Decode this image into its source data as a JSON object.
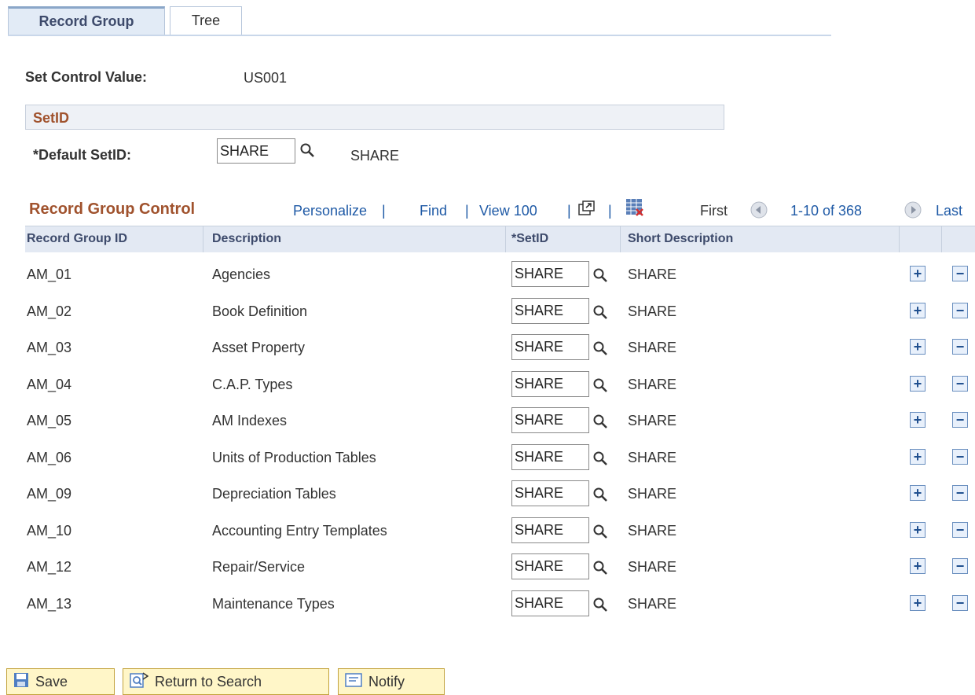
{
  "tabs": [
    {
      "label": "Record Group",
      "active": true
    },
    {
      "label": "Tree",
      "active": false
    }
  ],
  "set_control": {
    "label": "Set Control Value:",
    "value": "US001"
  },
  "setid_section": {
    "title": "SetID",
    "default_label": "*Default SetID:",
    "default_value": "SHARE",
    "default_description": "SHARE"
  },
  "grid": {
    "title": "Record Group Control",
    "personalize": "Personalize",
    "find": "Find",
    "view_all": "View 100",
    "sep": "|",
    "first": "First",
    "range": "1-10 of 368",
    "last": "Last",
    "columns": {
      "record_group_id": "Record Group ID",
      "description": "Description",
      "setid": "*SetID",
      "short_description": "Short Description"
    },
    "rows": [
      {
        "id": "AM_01",
        "description": "Agencies",
        "setid": "SHARE",
        "short": "SHARE"
      },
      {
        "id": "AM_02",
        "description": "Book Definition",
        "setid": "SHARE",
        "short": "SHARE"
      },
      {
        "id": "AM_03",
        "description": "Asset Property",
        "setid": "SHARE",
        "short": "SHARE"
      },
      {
        "id": "AM_04",
        "description": "C.A.P. Types",
        "setid": "SHARE",
        "short": "SHARE"
      },
      {
        "id": "AM_05",
        "description": "AM Indexes",
        "setid": "SHARE",
        "short": "SHARE"
      },
      {
        "id": "AM_06",
        "description": "Units of Production Tables",
        "setid": "SHARE",
        "short": "SHARE"
      },
      {
        "id": "AM_09",
        "description": "Depreciation Tables",
        "setid": "SHARE",
        "short": "SHARE"
      },
      {
        "id": "AM_10",
        "description": "Accounting Entry Templates",
        "setid": "SHARE",
        "short": "SHARE"
      },
      {
        "id": "AM_12",
        "description": "Repair/Service",
        "setid": "SHARE",
        "short": "SHARE"
      },
      {
        "id": "AM_13",
        "description": "Maintenance Types",
        "setid": "SHARE",
        "short": "SHARE"
      }
    ]
  },
  "toolbar": {
    "save": "Save",
    "return_to_search": "Return to Search",
    "notify": "Notify"
  },
  "colors": {
    "section_title": "#a0522d",
    "link": "#1f5aa6",
    "header_bg": "#e3e9f3",
    "button_bg": "#fff6c8"
  },
  "icons": [
    "lookup-icon",
    "zoom-icon",
    "download-icon",
    "prev-arrow-icon",
    "next-arrow-icon",
    "add-row-icon",
    "delete-row-icon",
    "save-icon",
    "return-to-search-icon",
    "notify-icon"
  ]
}
